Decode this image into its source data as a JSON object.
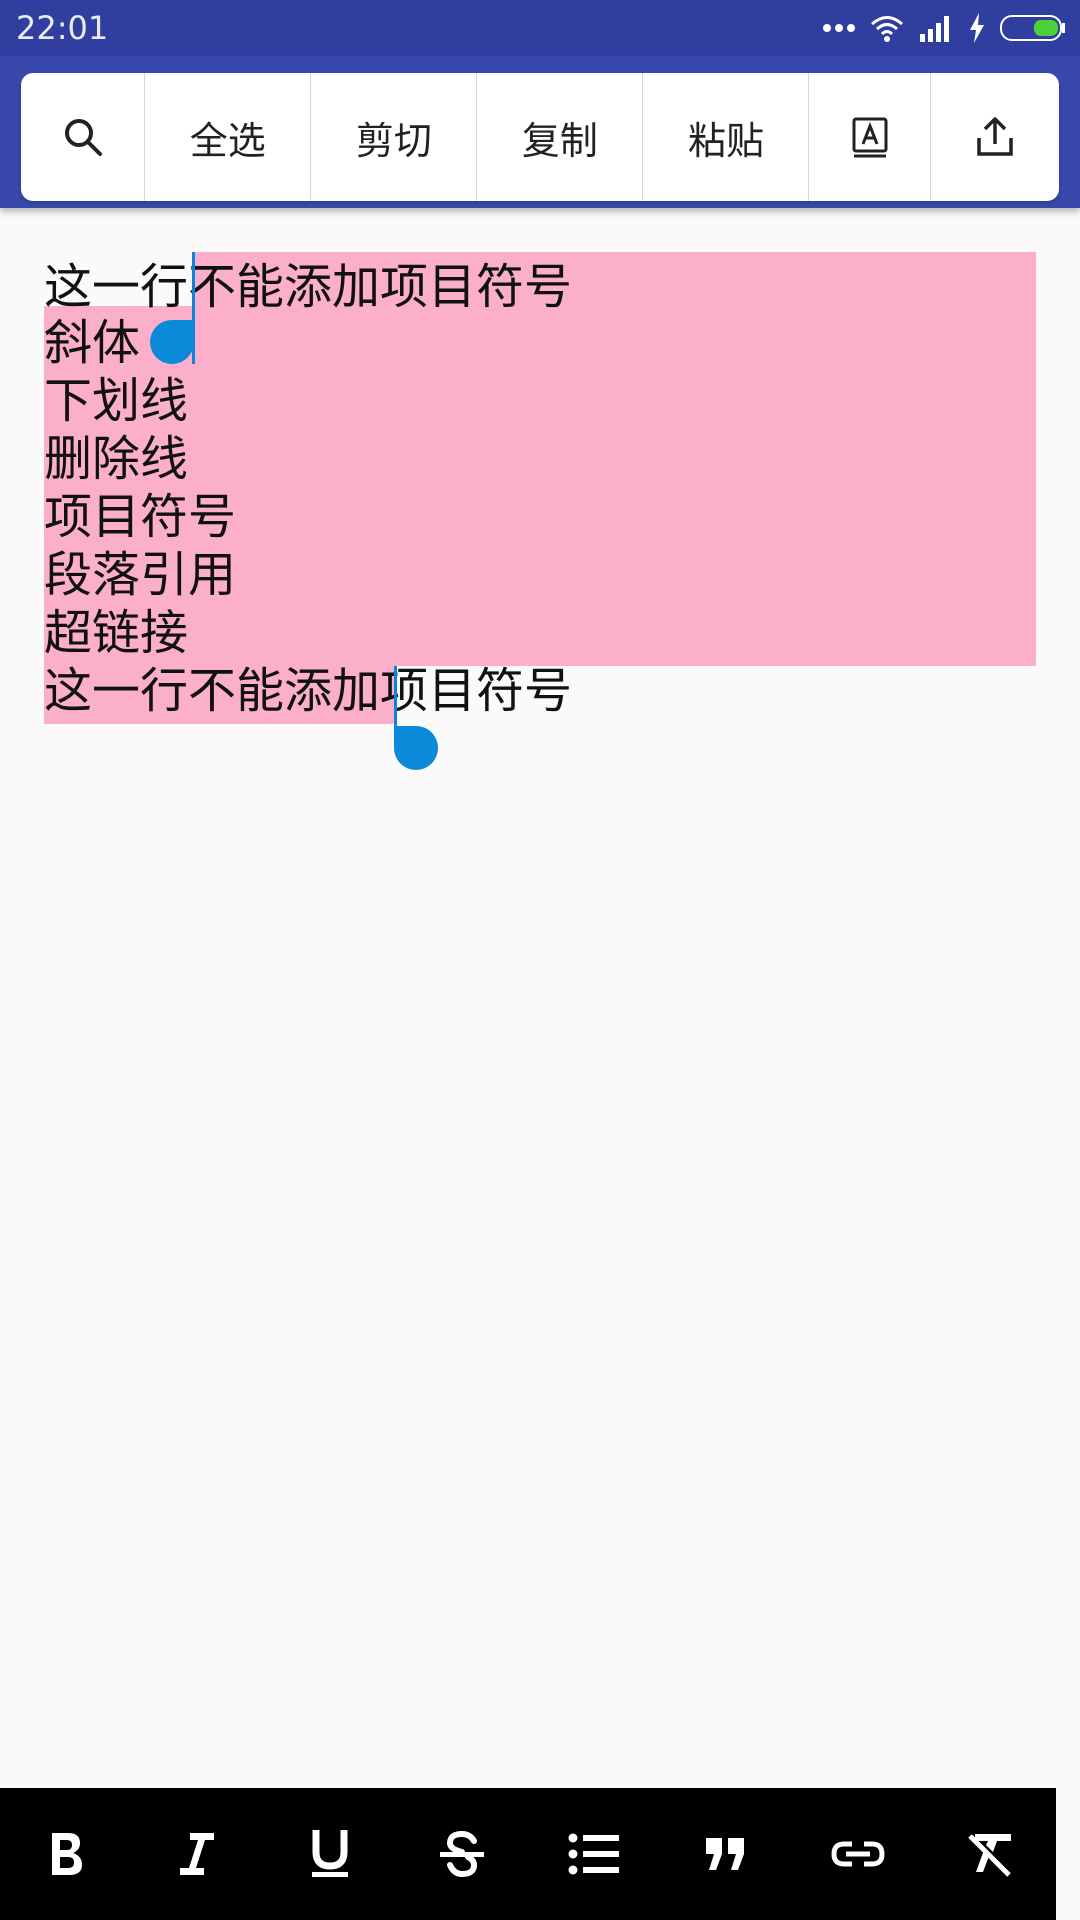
{
  "status_bar": {
    "time": "22:01"
  },
  "action_menu": {
    "items": [
      {
        "label": "",
        "icon": "search-icon"
      },
      {
        "label": "全选"
      },
      {
        "label": "剪切"
      },
      {
        "label": "复制"
      },
      {
        "label": "粘贴"
      },
      {
        "label": "",
        "icon": "text-assist-icon"
      },
      {
        "label": "",
        "icon": "share-icon"
      }
    ]
  },
  "editor": {
    "lines": [
      "这一行不能添加项目符号",
      "斜体",
      "下划线",
      "删除线",
      "项目符号",
      "段落引用",
      "超链接",
      "这一行不能添加项目符号"
    ],
    "selection_color": "#fbafcb",
    "handle_color": "#0a8ad8"
  },
  "format_toolbar": {
    "buttons": [
      "bold-icon",
      "italic-icon",
      "underline-icon",
      "strikethrough-icon",
      "bullet-list-icon",
      "quote-icon",
      "link-icon",
      "clear-format-icon"
    ]
  }
}
